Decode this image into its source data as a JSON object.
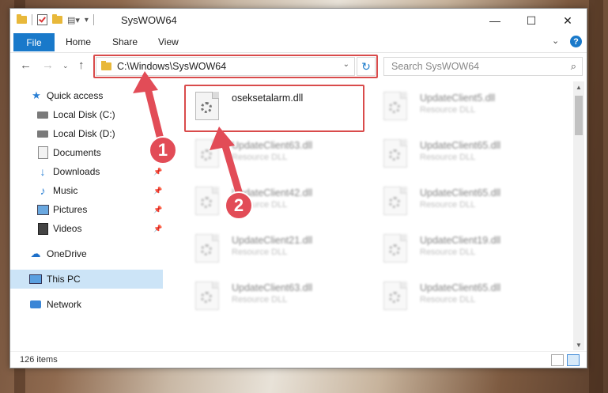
{
  "window": {
    "title": "SysWOW64"
  },
  "ribbon": {
    "tabs": [
      "File",
      "Home",
      "Share",
      "View"
    ]
  },
  "address": {
    "path": "C:\\Windows\\SysWOW64"
  },
  "search": {
    "placeholder": "Search SysWOW64"
  },
  "sidebar": {
    "items": [
      {
        "label": "Quick access",
        "icon": "star-icon",
        "pinned": false
      },
      {
        "label": "Local Disk (C:)",
        "icon": "drive-icon",
        "pinned": true
      },
      {
        "label": "Local Disk (D:)",
        "icon": "drive-icon",
        "pinned": true
      },
      {
        "label": "Documents",
        "icon": "documents-icon",
        "pinned": true
      },
      {
        "label": "Downloads",
        "icon": "download-arrow-icon",
        "pinned": true
      },
      {
        "label": "Music",
        "icon": "music-note-icon",
        "pinned": true
      },
      {
        "label": "Pictures",
        "icon": "pictures-icon",
        "pinned": true
      },
      {
        "label": "Videos",
        "icon": "videos-icon",
        "pinned": true
      },
      {
        "label": "OneDrive",
        "icon": "cloud-icon",
        "pinned": false
      },
      {
        "label": "This PC",
        "icon": "computer-icon",
        "pinned": false,
        "selected": true
      },
      {
        "label": "Network",
        "icon": "network-icon",
        "pinned": false
      }
    ]
  },
  "files": [
    {
      "name": "oseksetalarm.dll",
      "type": "",
      "highlighted": true
    },
    {
      "name": "UpdateClient5.dll",
      "type": "Resource DLL"
    },
    {
      "name": "UpdateClient63.dll",
      "type": "Resource DLL"
    },
    {
      "name": "UpdateClient65.dll",
      "type": "Resource DLL"
    },
    {
      "name": "UpdateClient42.dll",
      "type": "Resource DLL"
    },
    {
      "name": "UpdateClient65.dll",
      "type": "Resource DLL"
    },
    {
      "name": "UpdateClient21.dll",
      "type": "Resource DLL"
    },
    {
      "name": "UpdateClient19.dll",
      "type": "Resource DLL"
    },
    {
      "name": "UpdateClient63.dll",
      "type": "Resource DLL"
    },
    {
      "name": "UpdateClient65.dll",
      "type": "Resource DLL"
    }
  ],
  "status": {
    "item_count": "126 items"
  },
  "annotations": {
    "step1": "1",
    "step2": "2",
    "accent_color": "#e24c57"
  }
}
